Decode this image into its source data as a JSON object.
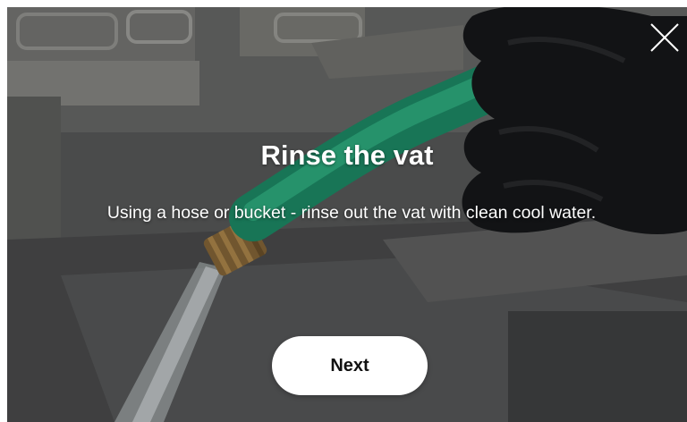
{
  "dialog": {
    "title": "Rinse the vat",
    "instruction": "Using a hose or bucket - rinse out the vat with clean cool water.",
    "next_label": "Next"
  },
  "icons": {
    "close": "close-icon"
  },
  "colors": {
    "hose": "#2aa67d",
    "glove": "#17181a",
    "button_bg": "#ffffff",
    "button_text": "#111111",
    "title_text": "#ffffff"
  }
}
